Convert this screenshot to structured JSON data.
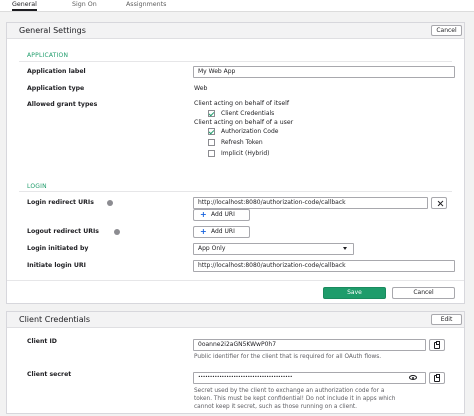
{
  "tabs": [
    {
      "label": "General",
      "active": true
    },
    {
      "label": "Sign On",
      "active": false
    },
    {
      "label": "Assignments",
      "active": false
    }
  ],
  "general_settings": {
    "title": "General Settings",
    "cancel_label": "Cancel",
    "application_section": "APPLICATION",
    "app_label_label": "Application label",
    "app_label_value": "My Web App",
    "app_type_label": "Application type",
    "app_type_value": "Web",
    "grant_types_label": "Allowed grant types",
    "grant_group_self": "Client acting on behalf of itself",
    "grant_client_credentials": "Client Credentials",
    "grant_group_user": "Client acting on behalf of a user",
    "grant_authorization_code": "Authorization Code",
    "grant_refresh_token": "Refresh Token",
    "grant_implicit": "Implicit (Hybrid)",
    "grant_checked": {
      "client_credentials": true,
      "authorization_code": true,
      "refresh_token": false,
      "implicit": false
    },
    "login_section": "LOGIN",
    "login_redirect_label": "Login redirect URIs",
    "login_redirect_value": "http://localhost:8080/authorization-code/callback",
    "add_uri_label": "Add URI",
    "logout_redirect_label": "Logout redirect URIs",
    "login_initiated_label": "Login initiated by",
    "login_initiated_value": "App Only",
    "initiate_login_label": "Initiate login URI",
    "initiate_login_value": "http://localhost:8080/authorization-code/callback",
    "save_label": "Save",
    "cancel_bottom_label": "Cancel"
  },
  "client_credentials": {
    "title": "Client Credentials",
    "edit_label": "Edit",
    "client_id_label": "Client ID",
    "client_id_value": "0oanne2i2aGN5KWwP0h7",
    "client_id_help": "Public identifier for the client that is required for all OAuth flows.",
    "client_secret_label": "Client secret",
    "client_secret_value": "••••••••••••••••••••••••••••••••••••••••",
    "client_secret_help_1": "Secret used by the client to exchange an authorization code for a",
    "client_secret_help_2": "token. This must be kept confidential! Do not include it in apps which",
    "client_secret_help_3": "cannot keep it secret, such as those running on a client."
  },
  "colors": {
    "accent": "#1e9c6b",
    "link": "#1662dd"
  }
}
